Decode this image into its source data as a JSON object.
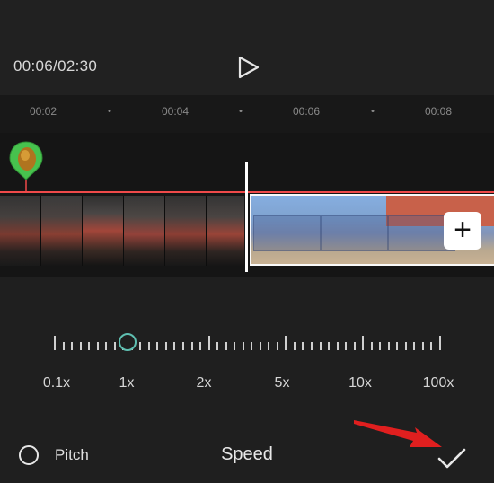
{
  "header": {
    "timecode": "00:06/02:30",
    "play_icon": "play-icon"
  },
  "ruler": {
    "labels": [
      "00:02",
      "00:04",
      "00:06",
      "00:08"
    ]
  },
  "timeline": {
    "marker_icon": "sticker-marker-icon",
    "add_label": "+"
  },
  "speed": {
    "options": [
      "0.1x",
      "1x",
      "2x",
      "5x",
      "10x",
      "100x"
    ],
    "selected": "1x",
    "accent": "#5fbfb1"
  },
  "footer": {
    "pitch_label": "Pitch",
    "title": "Speed",
    "confirm_icon": "checkmark-icon"
  },
  "colors": {
    "background": "#1f1f1f",
    "playhead_line": "#ef4a4a",
    "annotation_arrow": "#e01f1f"
  }
}
